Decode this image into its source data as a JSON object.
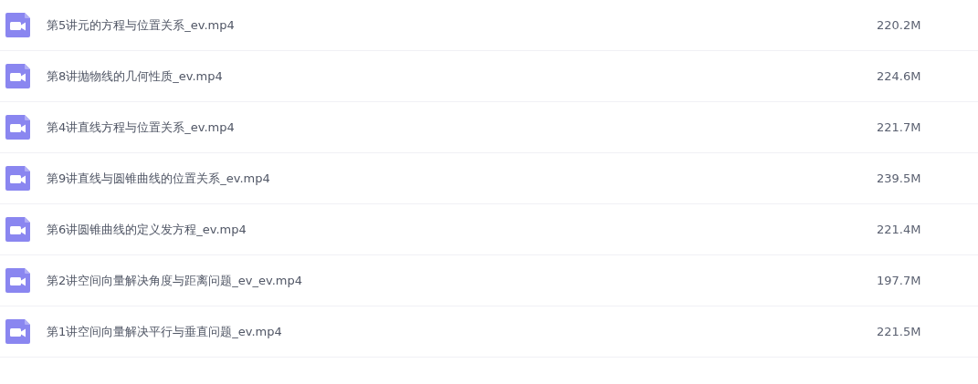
{
  "files": [
    {
      "name": "第5讲元的方程与位置关系_ev.mp4",
      "size": "220.2M"
    },
    {
      "name": "第8讲抛物线的几何性质_ev.mp4",
      "size": "224.6M"
    },
    {
      "name": "第4讲直线方程与位置关系_ev.mp4",
      "size": "221.7M"
    },
    {
      "name": "第9讲直线与圆锥曲线的位置关系_ev.mp4",
      "size": "239.5M"
    },
    {
      "name": "第6讲圆锥曲线的定义发方程_ev.mp4",
      "size": "221.4M"
    },
    {
      "name": "第2讲空间向量解决角度与距离问题_ev_ev.mp4",
      "size": "197.7M"
    },
    {
      "name": "第1讲空间向量解决平行与垂直问题_ev.mp4",
      "size": "221.5M"
    }
  ]
}
